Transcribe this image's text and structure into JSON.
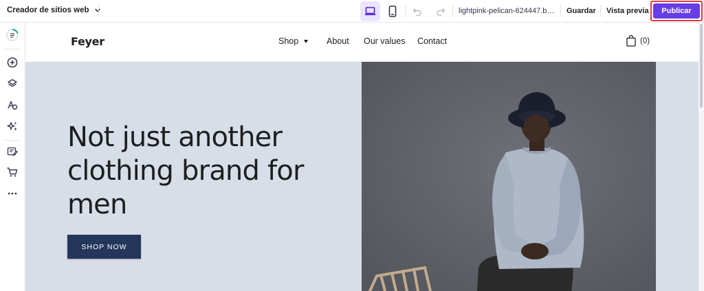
{
  "toolbar": {
    "app_title": "Creador de sitios web",
    "domain": "lightpink-pelican-624447.buil...",
    "save_label": "Guardar",
    "preview_label": "Vista previa",
    "publish_label": "Publicar",
    "accent_color": "#673de6"
  },
  "sidebar": {
    "items": [
      {
        "icon": "progress-checklist-icon"
      },
      {
        "icon": "add-section-icon"
      },
      {
        "icon": "layers-icon"
      },
      {
        "icon": "styles-icon"
      },
      {
        "icon": "ai-tools-icon"
      },
      {
        "icon": "blog-icon"
      },
      {
        "icon": "store-icon"
      },
      {
        "icon": "more-icon"
      }
    ]
  },
  "site": {
    "logo": "Feyer",
    "nav": {
      "shop": "Shop",
      "about": "About",
      "values": "Our values",
      "contact": "Contact"
    },
    "cart_count": "(0)",
    "hero": {
      "title": "Not just another clothing brand for men",
      "button": "SHOP NOW",
      "bg_color": "#d8dee8",
      "button_color": "#24365a"
    }
  }
}
